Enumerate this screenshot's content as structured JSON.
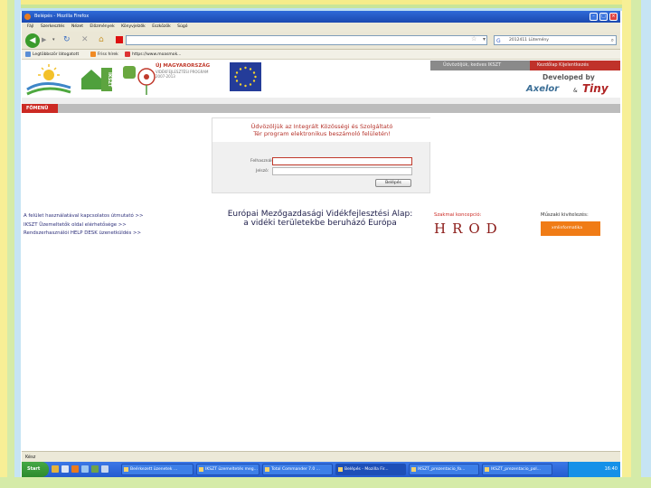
{
  "browser": {
    "title": "Belépés - Mozilla Firefox",
    "menu": [
      "Fájl",
      "Szerkesztés",
      "Nézet",
      "Előzmények",
      "Könyvjelzők",
      "Eszközök",
      "Súgó"
    ],
    "search_text": "2012411 Lütemény",
    "bookmarks": [
      "Legtöbbször látogatott",
      "Friss hírek",
      "https://www.moasmok..."
    ],
    "colors": {
      "titlebar": "#2f6ad8",
      "accent": "#cc2a24"
    }
  },
  "page": {
    "header": {
      "umfv_title": "ÚJ MAGYARORSZÁG",
      "umfv_line1": "VIDÉKFEJLESZTÉSI PROGRAM",
      "umfv_line2": "2007-2013",
      "iksz_label": "IKSZT",
      "welcome": "Üdvözöljük, kedves IKSZT",
      "links": "Kezdőlap Kijelentkezés",
      "developed_by": "Developed by",
      "axelor": "Axelor",
      "ampersand": "&",
      "tiny": "Tiny"
    },
    "menu_label": "FŐMENÜ",
    "login": {
      "heading_line1": "Üdvözöljük az Integrált Közösségi és Szolgáltató",
      "heading_line2": "Tér program elektronikus beszámoló felületén!",
      "username_label": "Felhasználó:",
      "password_label": "Jelszó:",
      "button_label": "Belépés"
    },
    "links": [
      "A felület használatával kapcsolatos útmutató >>",
      "IKSZT Üzemeltetők oldal elérhetősége >>",
      "Rendszerhasználói HELP DESK üzenetküldés >>"
    ],
    "eu_line1": "Európai Mezőgazdasági Vidékfejlesztési Alap:",
    "eu_line2": "a vidéki területekbe beruházó Európa",
    "szakmai_label": "Szakmai koncepció:",
    "hrod": "HROD",
    "muszaki_label": "Műszaki kivitelezés:",
    "muszaki_logo": "xmlinformatika"
  },
  "status": {
    "text": "Kész"
  },
  "taskbar": {
    "start": "Start",
    "tasks": [
      "Beérkezett üzenetek ...",
      "IKSZT üzemeltetés meg...",
      "Total Commander 7.0 ...",
      "Belépés - Mozilla Fir...",
      "IKSZT_prezentacio_fo...",
      "IKSZT_prezentacio_pol..."
    ],
    "clock": "16:40"
  }
}
